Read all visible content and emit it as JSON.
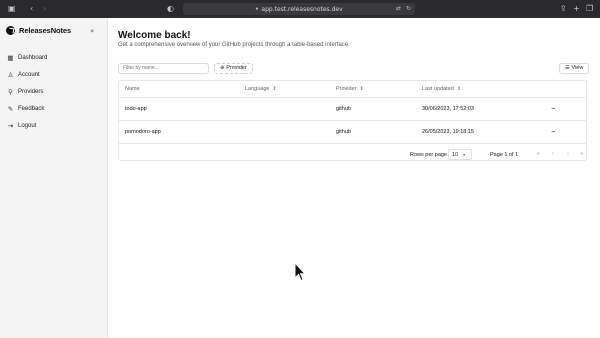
{
  "browser": {
    "url": "app.test.releasesnotes.dev",
    "controls": {
      "sidebar": "▣",
      "back": "‹",
      "forward": "›",
      "shield": "◐",
      "share": "⇪",
      "new_tab": "+",
      "tabs": "❐"
    }
  },
  "sidebar": {
    "brand": "ReleasesNotes",
    "collapse_icon": "«",
    "items": [
      {
        "label": "Dashboard",
        "icon": "dashboard-icon",
        "glyph": "▦"
      },
      {
        "label": "Account",
        "icon": "user-icon",
        "glyph": "♙"
      },
      {
        "label": "Providers",
        "icon": "plug-icon",
        "glyph": "⚲"
      },
      {
        "label": "Feedback",
        "icon": "feedback-icon",
        "glyph": "✎"
      },
      {
        "label": "Logout",
        "icon": "logout-icon",
        "glyph": "⇥"
      }
    ]
  },
  "main": {
    "title": "Welcome back!",
    "subtitle": "Get a comprehensive overview of your GitHub projects through a table-based interface.",
    "filter_placeholder": "Filter by name...",
    "provider_button": "Provider",
    "view_button": "View",
    "table": {
      "headers": {
        "name": "Name",
        "language": "Language",
        "provider": "Provider",
        "last_updated": "Last updated"
      },
      "rows": [
        {
          "name": "todo-app",
          "language": "",
          "provider": "github",
          "last_updated": "30/06/2023, 17:52:03"
        },
        {
          "name": "pomodoro-app",
          "language": "",
          "provider": "github",
          "last_updated": "26/05/2023, 19:18:15"
        }
      ]
    },
    "pagination": {
      "rows_per_page_label": "Rows per page",
      "rows_per_page": "10",
      "page_info": "Page 1 of 1"
    }
  }
}
